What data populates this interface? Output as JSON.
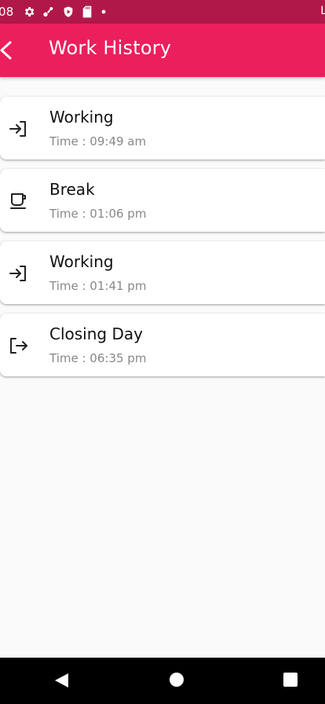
{
  "status_bar": {
    "time": "08",
    "right_text": "L"
  },
  "app_bar": {
    "title": "Work History"
  },
  "entries": [
    {
      "icon": "login-icon",
      "title": "Working",
      "time": "Time : 09:49 am"
    },
    {
      "icon": "coffee-cup-icon",
      "title": "Break",
      "time": "Time : 01:06 pm"
    },
    {
      "icon": "login-icon",
      "title": "Working",
      "time": "Time : 01:41 pm"
    },
    {
      "icon": "logout-icon",
      "title": "Closing Day",
      "time": "Time : 06:35 pm"
    }
  ],
  "colors": {
    "status_bar": "#b0184a",
    "app_bar": "#ec1f5d",
    "background": "#fafafa"
  }
}
